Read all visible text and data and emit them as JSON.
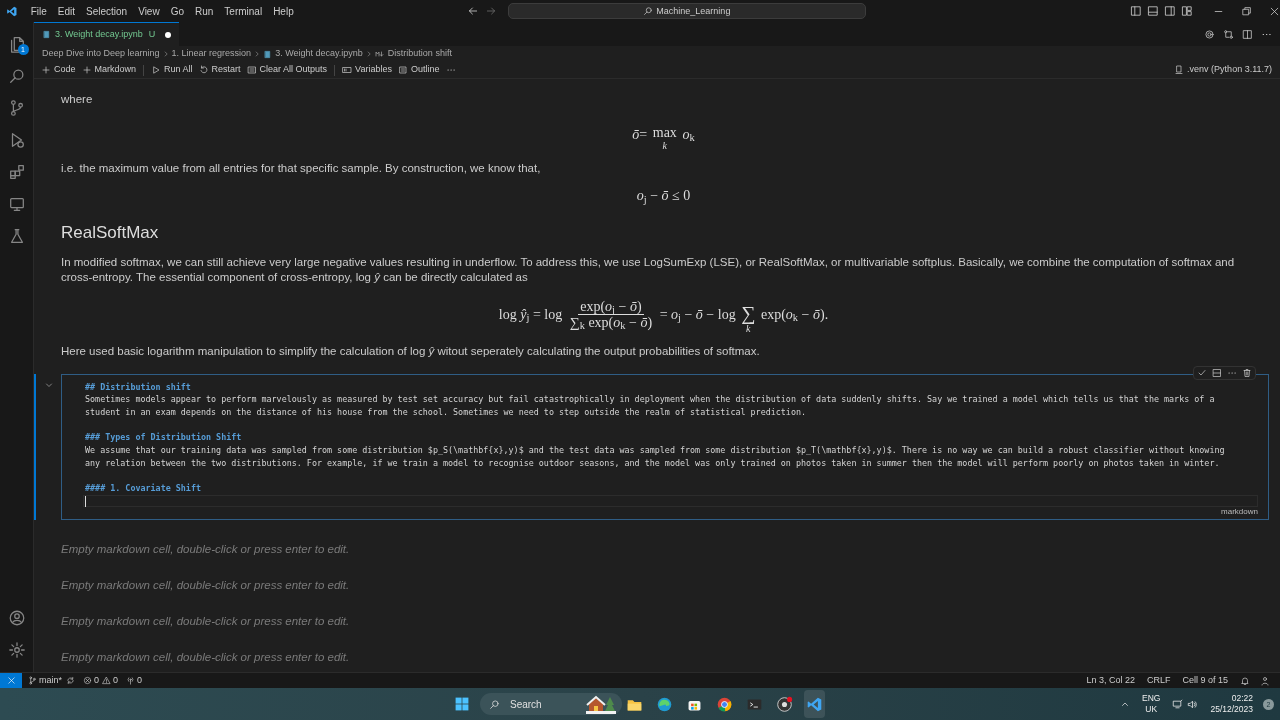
{
  "title_bar": {
    "menu": [
      "File",
      "Edit",
      "Selection",
      "View",
      "Go",
      "Run",
      "Terminal",
      "Help"
    ],
    "search": "Machine_Learning"
  },
  "activity_bar": {
    "badge": "1"
  },
  "tab": {
    "label": "3. Weight decay.ipynb",
    "status": "U",
    "dirty": true
  },
  "breadcrumbs": [
    {
      "kind": "folder",
      "label": "Deep Dive into Deep learning"
    },
    {
      "kind": "folder",
      "label": "1. Linear regression"
    },
    {
      "kind": "notebook",
      "label": "3. Weight decay.ipynb"
    },
    {
      "kind": "markdown",
      "label": "Distribution shift"
    }
  ],
  "toolbar": [
    [
      "Code",
      "Markdown"
    ],
    [
      "Run All",
      "Restart",
      "Clear All Outputs"
    ],
    [
      "Variables",
      "Outline"
    ]
  ],
  "kernel": ".venv (Python 3.11.7)",
  "cells": [
    {
      "kind": "rendered",
      "blocks": [
        {
          "kind": "paragraph",
          "text": "where"
        },
        {
          "kind": "math",
          "tokens": [
            {
              "kind": "text",
              "value": "*ō*= "
            },
            {
              "kind": "limit",
              "op": "max",
              "under": "*k*"
            },
            {
              "kind": "text",
              "value": " *o*$_{k}$"
            }
          ]
        },
        {
          "kind": "paragraph",
          "text": "i.e. the maximum value from all entries for that specific sample. By construction, we know that,"
        },
        {
          "kind": "math",
          "tokens": [
            {
              "kind": "text",
              "value": "*o*$_{j}$ − *ō* ≤ 0"
            }
          ]
        },
        {
          "kind": "heading",
          "text": "RealSoftMax"
        },
        {
          "kind": "paragraph",
          "text": "In modified softmax, we can still achieve very large negative values resulting in underflow. To address this, we use LogSumExp (LSE), or RealSoftMax, or multivariable softplus. Basically, we combine the computation of softmax and cross-entropy. The essential component of cross-entropy, log *ŷ* can be directly calculated as"
        },
        {
          "kind": "math",
          "tokens": [
            {
              "kind": "text",
              "value": "log *ŷ*$_{j}$ = log "
            },
            {
              "kind": "fraction",
              "numerator": "exp(*o*$_{j}$ − *ō*)",
              "denominator": "∑$_{k}$ exp(*o*$_{k}$ − *ō*)"
            },
            {
              "kind": "text",
              "value": " = *o*$_{j}$ − *ō* − log "
            },
            {
              "kind": "limit",
              "op": "∑",
              "under": "*k*"
            },
            {
              "kind": "text",
              "value": " exp(*o*$_{k}$ − *ō*)."
            }
          ]
        },
        {
          "kind": "paragraph",
          "text": "Here used basic logarithm manipulation to simplify the calculation of log *ŷ* witout seperately calculating the output probabilities of softmax."
        }
      ]
    },
    {
      "kind": "editing",
      "selected": true,
      "language": "markdown",
      "lines": [
        {
          "kind": "heading",
          "text": "## Distribution shift"
        },
        {
          "kind": "text",
          "text": "Sometimes models appear to perform marvelously as measured by test set accuracy but fail catastrophically in deployment when the distribution of data suddenly shifts. Say we trained a model which tells us that the marks of a"
        },
        {
          "kind": "text",
          "text": "student in an exam depends on the distance of his house from the school. Sometimes we need to step outside the realm of statistical prediction."
        },
        {
          "kind": "blank"
        },
        {
          "kind": "heading",
          "text": "### Types of Distribution Shift"
        },
        {
          "kind": "text",
          "text": "We assume that our training data was sampled from some distribution $p_S(\\mathbf{x},y)$ and the test data was sampled from some distribution $p_T(\\mathbf{x},y)$. There is no way we can build a robust classifier without knowing"
        },
        {
          "kind": "text",
          "text": "any relation between the two distributions. For example, if we train a model to recognise outdoor seasons, and the model was only trained on photos taken in summer then the model will perform poorly on photos taken in winter."
        },
        {
          "kind": "blank"
        },
        {
          "kind": "heading",
          "text": "#### 1. Covariate Shift"
        },
        {
          "kind": "cursor"
        }
      ]
    },
    {
      "kind": "empty",
      "text": "Empty markdown cell, double-click or press enter to edit."
    },
    {
      "kind": "empty",
      "text": "Empty markdown cell, double-click or press enter to edit."
    },
    {
      "kind": "empty",
      "text": "Empty markdown cell, double-click or press enter to edit."
    },
    {
      "kind": "empty",
      "text": "Empty markdown cell, double-click or press enter to edit."
    }
  ],
  "status_bar": {
    "branch": "main*",
    "errors": "0",
    "warnings": "0",
    "ports": "0",
    "right": [
      "Ln 3, Col 22",
      "CRLF",
      "Cell 9 of 15"
    ]
  },
  "taskbar": {
    "search": "Search",
    "language": [
      "ENG",
      "UK"
    ],
    "time": "02:22",
    "date": "25/12/2023",
    "notifications": "2"
  }
}
